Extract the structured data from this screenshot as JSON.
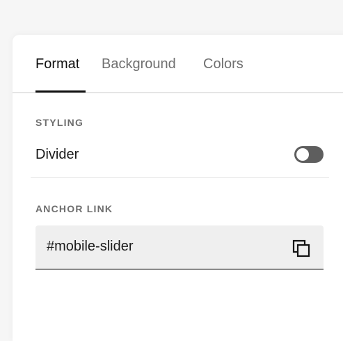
{
  "tabs": [
    {
      "label": "Format",
      "active": true
    },
    {
      "label": "Background",
      "active": false
    },
    {
      "label": "Colors",
      "active": false
    }
  ],
  "styling": {
    "section_label": "STYLING",
    "divider_label": "Divider",
    "divider_enabled": false
  },
  "anchor": {
    "section_label": "ANCHOR LINK",
    "value": "#mobile-slider",
    "copy_icon": "copy-icon"
  },
  "colors": {
    "active_tab": "#111111",
    "inactive_tab": "#707070",
    "toggle_off": "#5e5e5e",
    "field_bg": "#efefef"
  }
}
